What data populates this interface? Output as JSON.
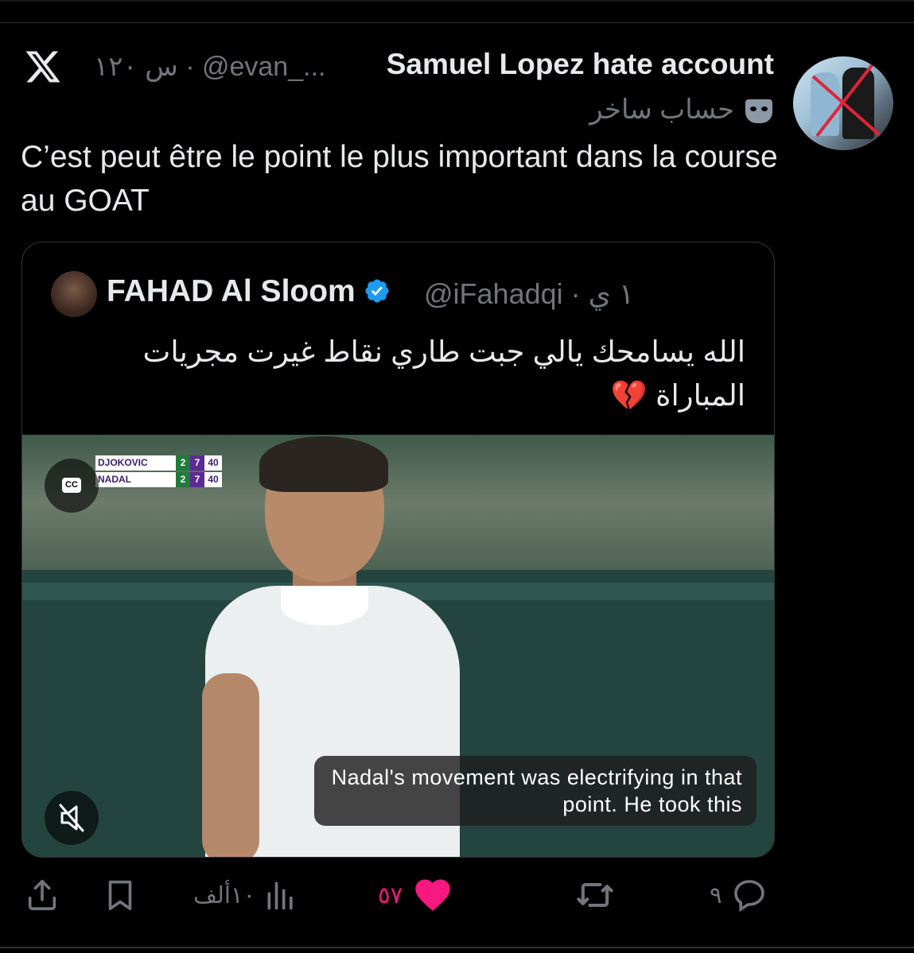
{
  "tweet": {
    "display_name": "Samuel Lopez hate account",
    "meta": "س ١٢٠ · @evan_...",
    "parody_label": "حساب ساخر",
    "text": "C’est peut être le point le plus important dans la course au GOAT"
  },
  "quote": {
    "display_name": "FAHAD Al Sloom",
    "handle_time": "@iFahadqi · ١ ي",
    "text": "الله يسامحك يالي جبت طاري نقاط غيرت مجريات المباراة",
    "emoji": "💔"
  },
  "video": {
    "scoreboard": [
      {
        "player": "DJOKOVIC",
        "sets": "2",
        "games": "7",
        "points": "40"
      },
      {
        "player": "NADAL",
        "sets": "2",
        "games": "7",
        "points": "40"
      }
    ],
    "cc_label": "CC",
    "caption": "Nadal's movement was electrifying in that point. He took this"
  },
  "actions": {
    "replies": "٩",
    "likes": "٥٧",
    "views": "١٠ألف"
  },
  "colors": {
    "background": "#000000",
    "text_primary": "#e7e9ea",
    "text_secondary": "#71767b",
    "like_active": "#f91880",
    "verified": "#1d9bf0"
  },
  "icons": [
    "x-logo-icon",
    "parody-mask-icon",
    "verified-badge-icon",
    "cc-icon",
    "mute-icon",
    "reply-icon",
    "retweet-icon",
    "heart-icon",
    "views-icon",
    "bookmark-icon",
    "share-icon"
  ]
}
